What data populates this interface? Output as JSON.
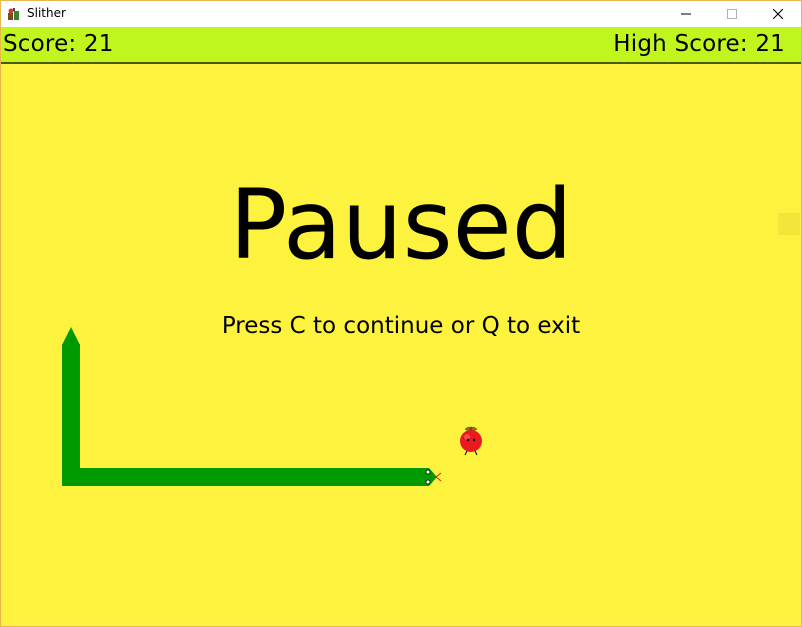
{
  "window": {
    "title": "Slither",
    "icon": "snake-app-icon",
    "controls": [
      "minimize-icon",
      "maximize-icon",
      "close-icon"
    ]
  },
  "scorebar": {
    "score_text": "Score: 21",
    "high_score_text": "High Score: 21"
  },
  "overlay": {
    "heading": "Paused",
    "hint": "Press C to continue or Q to exit"
  },
  "game": {
    "snake_color": "#009a00",
    "background_color": "#fdf23e",
    "scorebar_color": "#c0f51e",
    "apple_icon": "apple-icon"
  }
}
